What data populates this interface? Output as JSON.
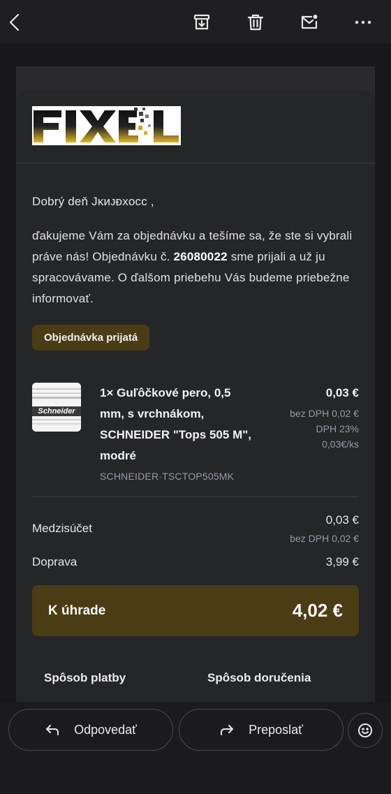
{
  "topbar": {
    "icons": [
      "back-arrow-icon",
      "archive-icon",
      "trash-icon",
      "mark-unread-icon",
      "more-icon"
    ]
  },
  "email": {
    "logo_text": "FIXEL",
    "greeting": "Dobrý deň Jĸᴎᴊᴆxocc ,",
    "paragraph": {
      "part1": "ďakujeme Vám za objednávku a tešíme sa, že ste si vybrali práve nás! Objednávku č. ",
      "order_number": "26080022",
      "part2": " sme prijali a už ju spracovávame. O ďalšom priebehu Vás budeme priebežne informovať."
    },
    "status_badge": "Objednávka prijatá",
    "product": {
      "thumb_brand": "Schneider",
      "name": "1× Guľôčkové pero, 0,5 mm, s vrchnákom, SCHNEIDER \"Tops 505 M\", modré",
      "sku": "SCHNEIDER·TSCTOP505MK",
      "price": "0,03 €",
      "price_ex_vat": "bez DPH 0,02 €",
      "vat": "DPH 23%",
      "unit_price": "0,03€/ks"
    },
    "subtotal": {
      "label": "Medzisúčet",
      "value": "0,03 €",
      "ex_vat": "bez DPH 0,02 €"
    },
    "shipping": {
      "label": "Doprava",
      "value": "3,99 €"
    },
    "total": {
      "label": "K úhrade",
      "value": "4,02 €"
    },
    "payment_title": "Spôsob platby",
    "delivery_title": "Spôsob doručenia"
  },
  "actions": {
    "reply_label": "Odpovedať",
    "forward_label": "Preposlať"
  },
  "colors": {
    "accent_gold": "#4a3c14",
    "background": "#1a1a1d",
    "card": "#25262a"
  }
}
